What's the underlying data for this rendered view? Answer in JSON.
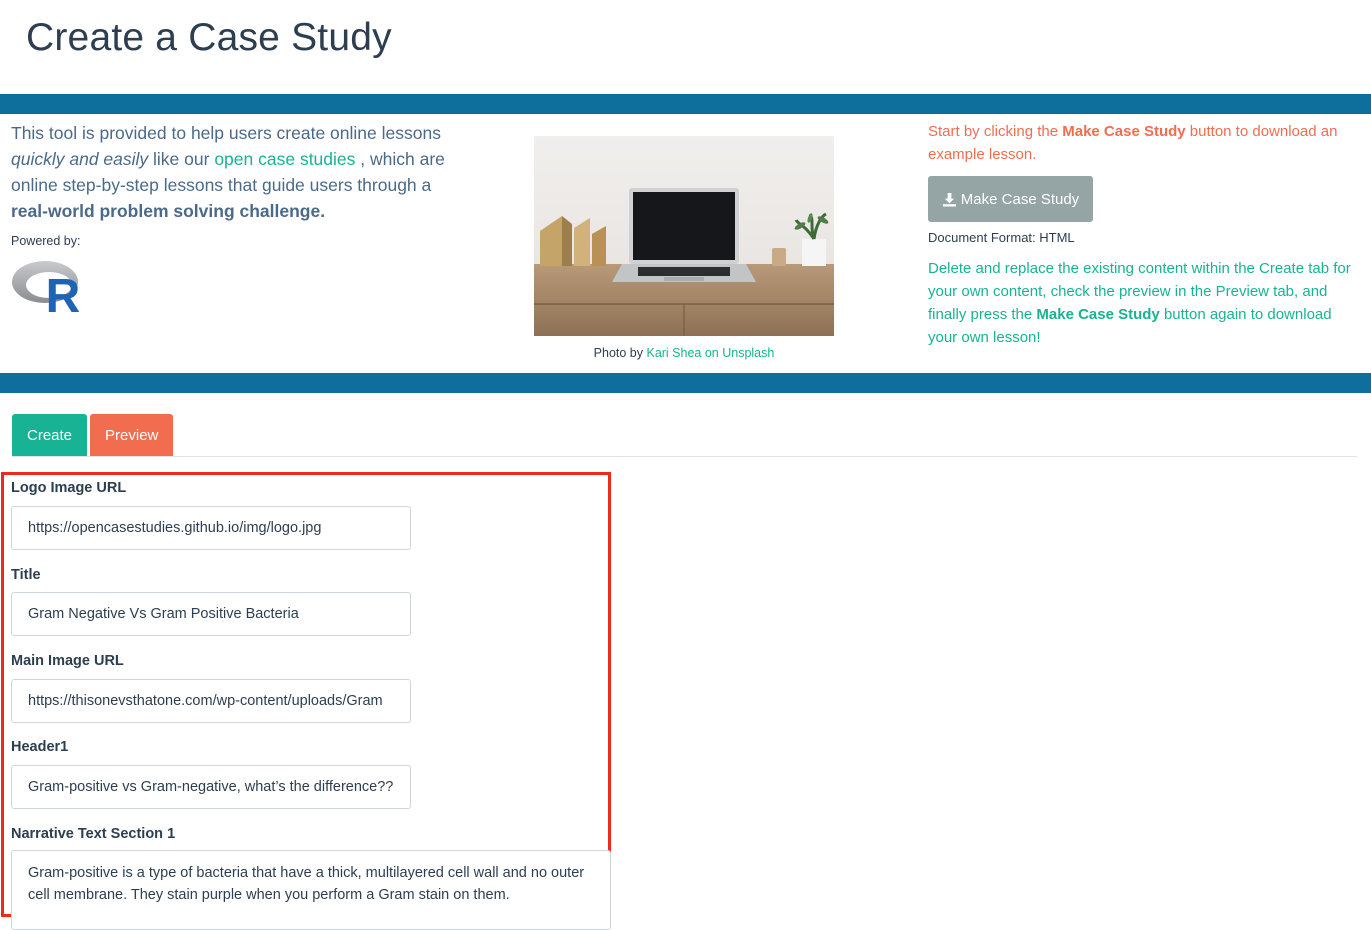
{
  "page": {
    "title": "Create a Case Study"
  },
  "intro": {
    "text_1": "This tool is provided to help users create online lessons",
    "emphasis": "quickly and easily",
    "text_2": "like our",
    "link": "open case studies",
    "text_3": ", which are online step-by-step lessons that guide users through a",
    "bold": "real-world problem solving challenge.",
    "powered_by": "Powered by:",
    "r_logo_letter": "R"
  },
  "photo": {
    "credit_prefix": "Photo by",
    "credit_link": "Kari Shea on Unsplash"
  },
  "right": {
    "start_1": "Start by clicking the",
    "start_bold": "Make Case Study",
    "start_2": "button to download an example lesson.",
    "make_button": "Make Case Study",
    "doc_format": "Document Format: HTML",
    "instr_1": "Delete and replace the existing content within the Create tab for your own content, check the preview in the Preview tab, and finally press the",
    "instr_bold": "Make Case Study",
    "instr_2": "button again to download your own lesson!"
  },
  "tabs": [
    {
      "label": "Create"
    },
    {
      "label": "Preview"
    }
  ],
  "form": {
    "logo_label": "Logo Image URL",
    "logo_value": "https://opencasestudies.github.io/img/logo.jpg",
    "title_label": "Title",
    "title_value": "Gram Negative Vs Gram Positive Bacteria",
    "main_image_label": "Main Image URL",
    "main_image_value": "https://thisonevsthatone.com/wp-content/uploads/Gram",
    "header1_label": "Header1",
    "header1_value": "Gram-positive vs Gram-negative, what’s the difference??",
    "narrative_label": "Narrative Text Section 1",
    "narrative_value": "Gram-positive is a type of bacteria that have a thick, multilayered cell wall and no outer cell membrane. They stain purple when you perform a Gram stain on them."
  },
  "colors": {
    "band": "#0e6f9c",
    "teal": "#18b394",
    "orange": "#f26d4f",
    "gray_button": "#95a5a6",
    "highlight_frame": "#ee2a1c"
  },
  "icons": {
    "download": "download-icon"
  }
}
